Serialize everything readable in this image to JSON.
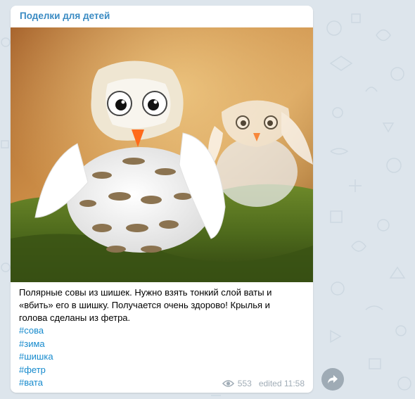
{
  "post": {
    "channel_name": "Поделки для детей",
    "image_icon": "photo-snowy-owls-pinecones",
    "text_lines": [
      "Полярные совы из шишек. Нужно взять тонкий слой ваты и",
      "«вбить» его в шишку. Получается очень здорово! Крылья и",
      "голова сделаны из фетра."
    ],
    "hashtags": [
      "#сова",
      "#зима",
      "#шишка",
      "#фетр",
      "#вата"
    ],
    "views": "553",
    "status": "edited 11:58"
  },
  "icons": {
    "views": "eye-icon",
    "share": "share-arrow-icon"
  },
  "colors": {
    "channel_name": "#3a8bc3",
    "hashtag": "#168acd",
    "meta": "#a0acb6",
    "background": "#dde5ec",
    "share_button": "#9fabb5"
  }
}
